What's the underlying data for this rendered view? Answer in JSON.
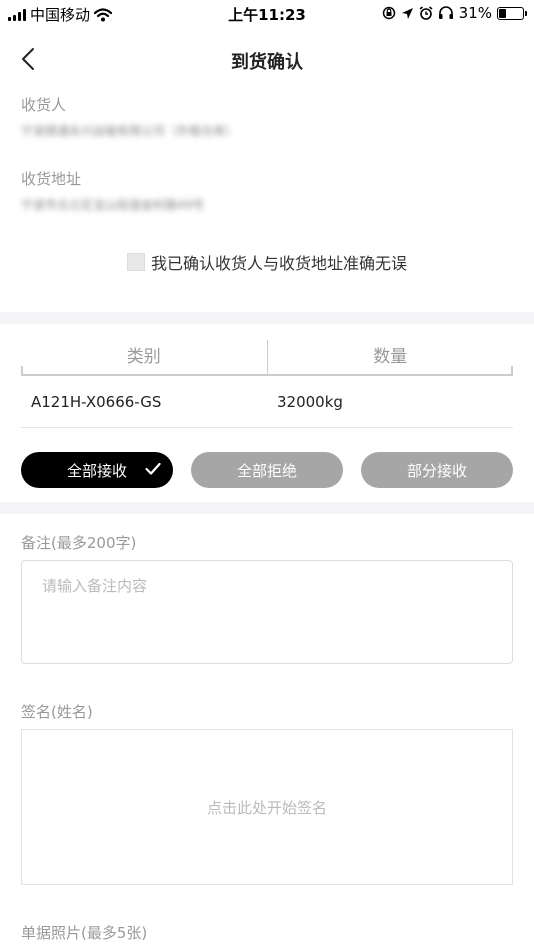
{
  "status_bar": {
    "carrier": "中国移动",
    "time": "上午11:23",
    "battery": "31%",
    "battery_level": 0.31
  },
  "nav": {
    "title": "到货确认",
    "back_icon": "chevron-left-icon"
  },
  "consignee": {
    "label": "收货人",
    "value": "宁波顺通永兴运输有限公司（外租仓库）"
  },
  "address": {
    "label": "收货地址",
    "value": "宁波市北仑区宝山街道金利路49号"
  },
  "confirm": {
    "label": "我已确认收货人与收货地址准确无误",
    "checked": false
  },
  "table": {
    "headers": [
      "类别",
      "数量"
    ],
    "rows": [
      {
        "category": "A121H-X0666-GS",
        "quantity": "32000kg"
      }
    ]
  },
  "actions": {
    "accept_all": "全部接收",
    "reject_all": "全部拒绝",
    "partial_accept": "部分接收",
    "selected": "accept_all"
  },
  "remark": {
    "label": "备注(最多200字)",
    "placeholder": "请输入备注内容",
    "value": ""
  },
  "signature": {
    "label": "签名(姓名)",
    "placeholder": "点击此处开始签名"
  },
  "photos": {
    "label": "单据照片(最多5张)"
  },
  "colors": {
    "active_button": "#000000",
    "inactive_button": "#a6a6a6",
    "band": "#f5f5f8"
  }
}
